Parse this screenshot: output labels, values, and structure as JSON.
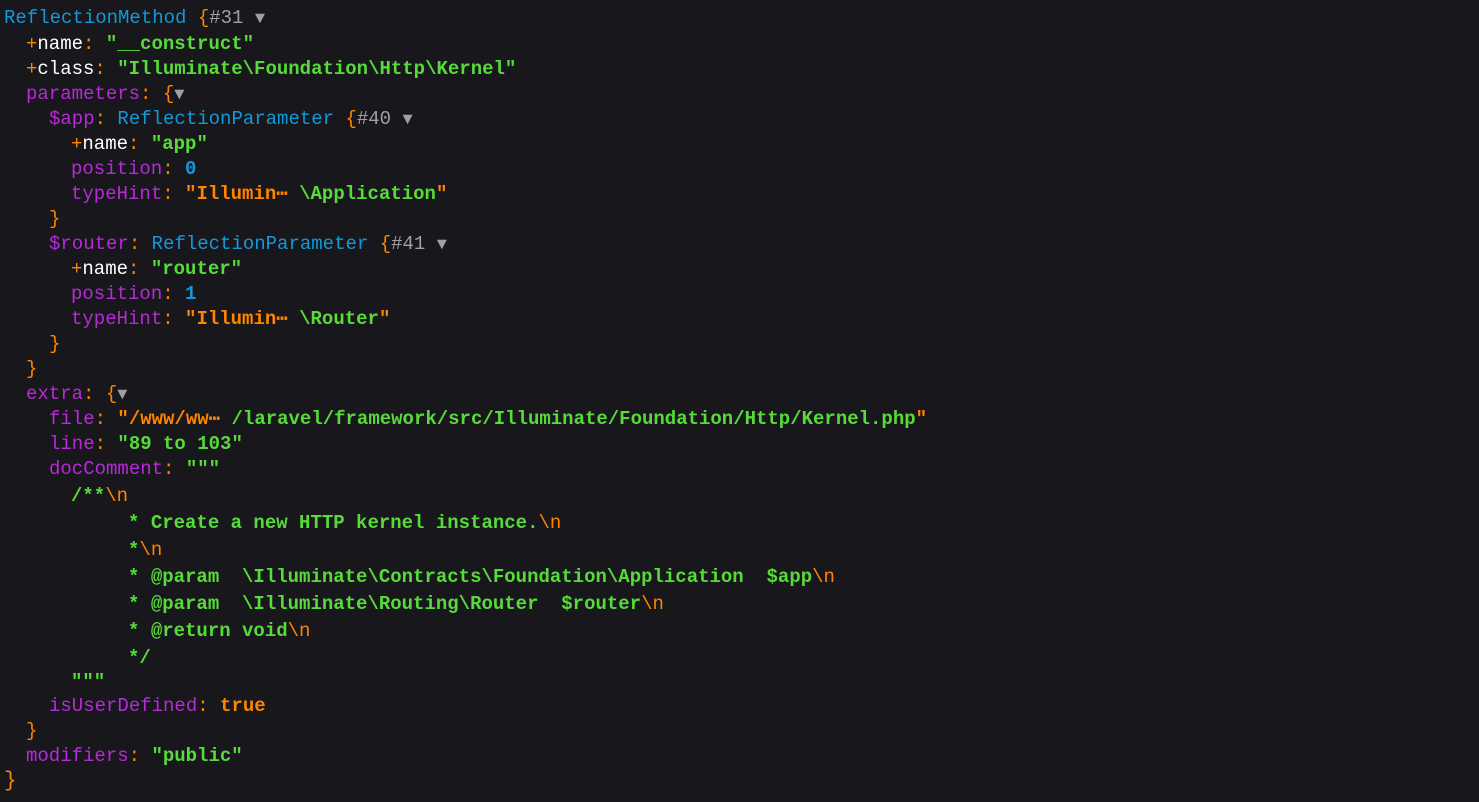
{
  "dump": {
    "root_class": "ReflectionMethod",
    "root_ref": "#31",
    "name_key": "name",
    "name_value": "__construct",
    "class_key": "class",
    "class_value": "Illuminate\\Foundation\\Http\\Kernel",
    "parameters_key": "parameters",
    "params": [
      {
        "var": "$app",
        "class": "ReflectionParameter",
        "ref": "#40",
        "name_value": "app",
        "position_value": "0",
        "typehint_prefix": "Illumin",
        "typehint_suffix": "\\Application"
      },
      {
        "var": "$router",
        "class": "ReflectionParameter",
        "ref": "#41",
        "name_value": "router",
        "position_value": "1",
        "typehint_prefix": "Illumin",
        "typehint_suffix": "\\Router"
      }
    ],
    "position_key": "position",
    "typehint_key": "typeHint",
    "extra_key": "extra",
    "file_key": "file",
    "file_prefix": "/www/ww",
    "file_suffix": "/laravel/framework/src/Illuminate/Foundation/Http/Kernel.php",
    "line_key": "line",
    "line_value": "89 to 103",
    "doccomment_key": "docComment",
    "doc_lines": [
      "/**",
      "     * Create a new HTTP kernel instance.",
      "     *",
      "     * @param  \\Illuminate\\Contracts\\Foundation\\Application  $app",
      "     * @param  \\Illuminate\\Routing\\Router  $router",
      "     * @return void",
      "     */"
    ],
    "newline_escape": "\\n",
    "isuserdefined_key": "isUserDefined",
    "isuserdefined_value": "true",
    "modifiers_key": "modifiers",
    "modifiers_value": "public",
    "ellipsis": "⋯",
    "toggle_glyph": "▼"
  },
  "colors": {
    "background": "#18171b",
    "class": "#1299da",
    "key": "#b729d9",
    "string": "#56db3a",
    "number": "#1299da",
    "punctuation": "#ff8400",
    "ref": "#a0a0a0",
    "default": "#ffffff"
  }
}
